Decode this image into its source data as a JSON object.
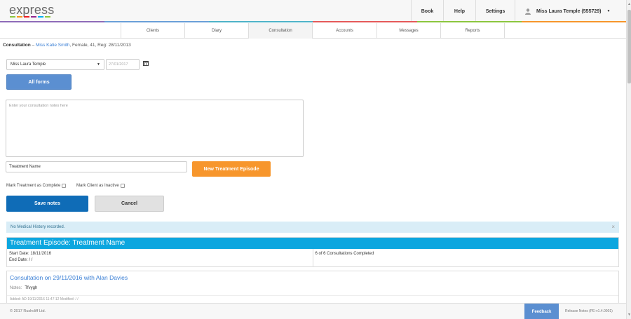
{
  "header": {
    "logo": "express",
    "logo_colors": [
      "#8cc63f",
      "#f7941d",
      "#ed1c24",
      "#92278f",
      "#00aeef",
      "#8cc63f"
    ],
    "nav": [
      {
        "label": "Book"
      },
      {
        "label": "Help"
      },
      {
        "label": "Settings"
      }
    ],
    "user": "Miss Laura Temple (555729)",
    "rainbow": [
      "#8e6bb8",
      "#6a9fd8",
      "#4fb3c8",
      "#e55a5a",
      "#8cc63f",
      "#f7962c"
    ]
  },
  "subnav": {
    "items": [
      {
        "label": "Clients"
      },
      {
        "label": "Diary"
      },
      {
        "label": "Consultation"
      },
      {
        "label": "Accounts"
      },
      {
        "label": "Messages"
      },
      {
        "label": "Reports"
      }
    ]
  },
  "breadcrumb": {
    "section": "Consultation",
    "separator": " – ",
    "client": "Miss Katie Smith",
    "details": ", Female, 41, Reg: 28/11/2013"
  },
  "form": {
    "practitioner": "Miss Laura Temple",
    "date_placeholder": "27/01/2017",
    "all_forms": "All forms",
    "notes_placeholder": "Enter your consultation notes here",
    "treatment_name": "Treatment Name",
    "new_episode": "New Treatment Episode",
    "mark_complete": "Mark Treatment as Complete",
    "mark_inactive": "Mark Client as Inactive",
    "save": "Save notes",
    "cancel": "Cancel"
  },
  "alert": {
    "text": "No Medical History recorded.",
    "close": "×"
  },
  "episode": {
    "title": "Treatment Episode: Treatment Name",
    "start": "Start Date: 18/11/2016",
    "end": "End Date: / /",
    "completed": "6 of 6 Consultations Completed"
  },
  "consultation": {
    "title": "Consultation on 29/11/2016 with Alan Davies",
    "notes_label": "Notes:",
    "notes_value": "Tfvygh",
    "added": "Added: AD 19/11/2016 11:47:12 Modified: / /"
  },
  "footer": {
    "copyright": "© 2017 Rushcliff Ltd.",
    "feedback": "Feedback",
    "release": "Release Notes (PE-v1.4.0001)"
  },
  "colors": {
    "primary_blue": "#5b8fd1",
    "save_blue": "#0f6cb7",
    "orange": "#f7962c",
    "cyan": "#0ca6df",
    "alert_bg": "#d9edf7"
  }
}
